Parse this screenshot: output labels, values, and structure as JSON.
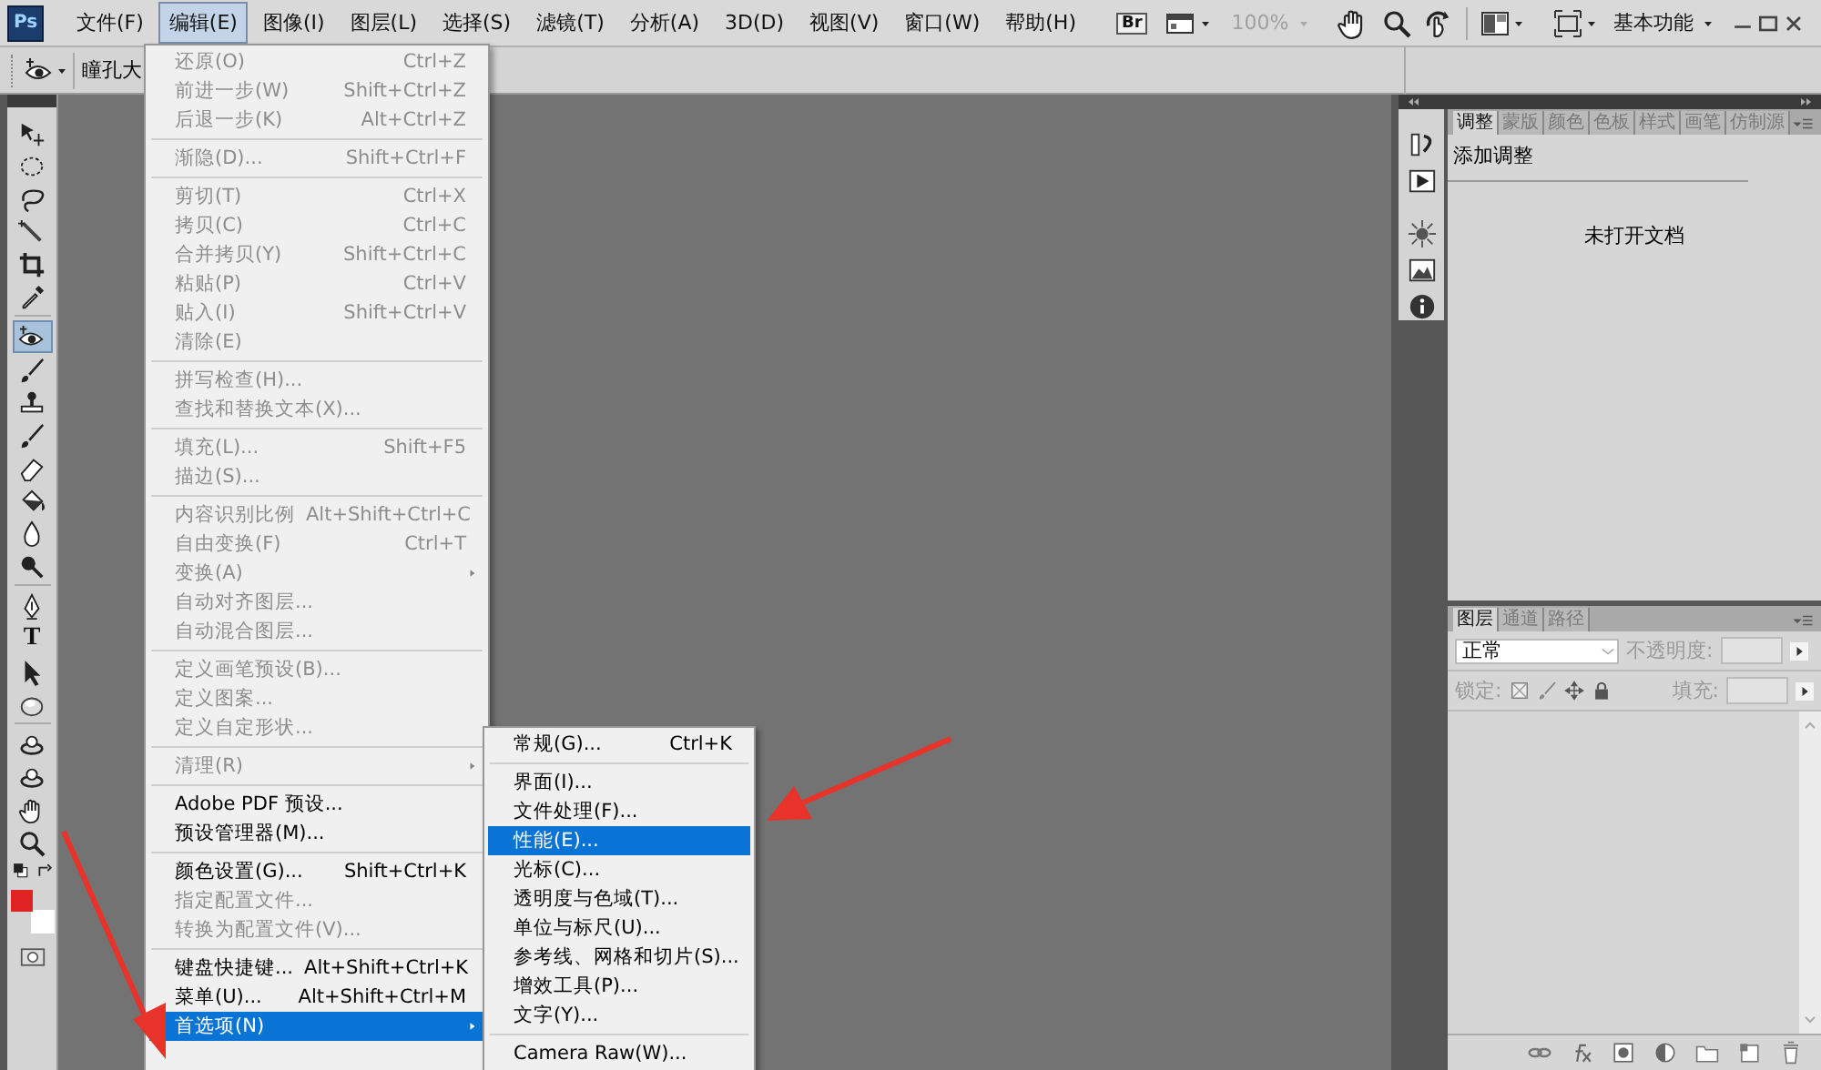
{
  "menubar": {
    "logo": "Ps",
    "items": [
      {
        "label": "文件(F)",
        "selected": false
      },
      {
        "label": "编辑(E)",
        "selected": true
      },
      {
        "label": "图像(I)",
        "selected": false
      },
      {
        "label": "图层(L)",
        "selected": false
      },
      {
        "label": "选择(S)",
        "selected": false
      },
      {
        "label": "滤镜(T)",
        "selected": false
      },
      {
        "label": "分析(A)",
        "selected": false
      },
      {
        "label": "3D(D)",
        "selected": false
      },
      {
        "label": "视图(V)",
        "selected": false
      },
      {
        "label": "窗口(W)",
        "selected": false
      },
      {
        "label": "帮助(H)",
        "selected": false
      }
    ],
    "bridge": "Br",
    "zoom": "100%",
    "workspace": "基本功能"
  },
  "options_bar": {
    "field_label": "瞳孔大"
  },
  "tools": [
    {
      "kind": "move",
      "selected": false
    },
    {
      "kind": "ellipse",
      "selected": false
    },
    {
      "kind": "lasso",
      "selected": false
    },
    {
      "kind": "wand",
      "selected": false
    },
    {
      "kind": "crop",
      "selected": false
    },
    {
      "kind": "eyedropper",
      "selected": false
    },
    {
      "kind": "eye",
      "selected": true
    },
    {
      "kind": "brush",
      "selected": false
    },
    {
      "kind": "stamp",
      "selected": false
    },
    {
      "kind": "brush",
      "selected": false
    },
    {
      "kind": "eraser",
      "selected": false
    },
    {
      "kind": "bucket",
      "selected": false
    },
    {
      "kind": "drop",
      "selected": false
    },
    {
      "kind": "dodge",
      "selected": false
    },
    {
      "kind": "pen",
      "selected": false
    },
    {
      "kind": "type",
      "glyph": "T",
      "selected": false
    },
    {
      "kind": "pointer",
      "selected": false
    },
    {
      "kind": "shape",
      "selected": false
    },
    {
      "kind": "orbit",
      "selected": false
    },
    {
      "kind": "orbit",
      "selected": false
    },
    {
      "kind": "hand",
      "selected": false
    },
    {
      "kind": "zoom",
      "selected": false
    }
  ],
  "swatches": [
    {
      "color": "#e02424"
    },
    {
      "color": "#ffffff"
    }
  ],
  "edit_menu": {
    "groups": [
      [
        {
          "label": "还原(O)",
          "shortcut": "Ctrl+Z",
          "disabled": true,
          "has_submenu": false,
          "selected": false
        },
        {
          "label": "前进一步(W)",
          "shortcut": "Shift+Ctrl+Z",
          "disabled": true,
          "has_submenu": false,
          "selected": false
        },
        {
          "label": "后退一步(K)",
          "shortcut": "Alt+Ctrl+Z",
          "disabled": true,
          "has_submenu": false,
          "selected": false
        }
      ],
      [
        {
          "label": "渐隐(D)...",
          "shortcut": "Shift+Ctrl+F",
          "disabled": true,
          "has_submenu": false,
          "selected": false
        }
      ],
      [
        {
          "label": "剪切(T)",
          "shortcut": "Ctrl+X",
          "disabled": true,
          "has_submenu": false,
          "selected": false
        },
        {
          "label": "拷贝(C)",
          "shortcut": "Ctrl+C",
          "disabled": true,
          "has_submenu": false,
          "selected": false
        },
        {
          "label": "合并拷贝(Y)",
          "shortcut": "Shift+Ctrl+C",
          "disabled": true,
          "has_submenu": false,
          "selected": false
        },
        {
          "label": "粘贴(P)",
          "shortcut": "Ctrl+V",
          "disabled": true,
          "has_submenu": false,
          "selected": false
        },
        {
          "label": "贴入(I)",
          "shortcut": "Shift+Ctrl+V",
          "disabled": true,
          "has_submenu": false,
          "selected": false
        },
        {
          "label": "清除(E)",
          "disabled": true,
          "has_submenu": false,
          "selected": false
        }
      ],
      [
        {
          "label": "拼写检查(H)...",
          "disabled": true,
          "has_submenu": false,
          "selected": false
        },
        {
          "label": "查找和替换文本(X)...",
          "disabled": true,
          "has_submenu": false,
          "selected": false
        }
      ],
      [
        {
          "label": "填充(L)...",
          "shortcut": "Shift+F5",
          "disabled": true,
          "has_submenu": false,
          "selected": false
        },
        {
          "label": "描边(S)...",
          "disabled": true,
          "has_submenu": false,
          "selected": false
        }
      ],
      [
        {
          "label": "内容识别比例",
          "shortcut": "Alt+Shift+Ctrl+C",
          "disabled": true,
          "has_submenu": false,
          "selected": false
        },
        {
          "label": "自由变换(F)",
          "shortcut": "Ctrl+T",
          "disabled": true,
          "has_submenu": false,
          "selected": false
        },
        {
          "label": "变换(A)",
          "disabled": true,
          "has_submenu": true,
          "selected": false
        },
        {
          "label": "自动对齐图层...",
          "disabled": true,
          "has_submenu": false,
          "selected": false
        },
        {
          "label": "自动混合图层...",
          "disabled": true,
          "has_submenu": false,
          "selected": false
        }
      ],
      [
        {
          "label": "定义画笔预设(B)...",
          "disabled": true,
          "has_submenu": false,
          "selected": false
        },
        {
          "label": "定义图案...",
          "disabled": true,
          "has_submenu": false,
          "selected": false
        },
        {
          "label": "定义自定形状...",
          "disabled": true,
          "has_submenu": false,
          "selected": false
        }
      ],
      [
        {
          "label": "清理(R)",
          "disabled": true,
          "has_submenu": true,
          "selected": false
        }
      ],
      [
        {
          "label": "Adobe PDF 预设...",
          "disabled": false,
          "has_submenu": false,
          "selected": false
        },
        {
          "label": "预设管理器(M)...",
          "disabled": false,
          "has_submenu": false,
          "selected": false
        }
      ],
      [
        {
          "label": "颜色设置(G)...",
          "shortcut": "Shift+Ctrl+K",
          "disabled": false,
          "has_submenu": false,
          "selected": false
        },
        {
          "label": "指定配置文件...",
          "disabled": true,
          "has_submenu": false,
          "selected": false
        },
        {
          "label": "转换为配置文件(V)...",
          "disabled": true,
          "has_submenu": false,
          "selected": false
        }
      ],
      [
        {
          "label": "键盘快捷键...",
          "shortcut": "Alt+Shift+Ctrl+K",
          "disabled": false,
          "has_submenu": false,
          "selected": false
        },
        {
          "label": "菜单(U)...",
          "shortcut": "Alt+Shift+Ctrl+M",
          "disabled": false,
          "has_submenu": false,
          "selected": false
        },
        {
          "label": "首选项(N)",
          "disabled": false,
          "has_submenu": true,
          "selected": true
        }
      ]
    ]
  },
  "submenu": {
    "groups": [
      [
        {
          "label": "常规(G)...",
          "shortcut": "Ctrl+K",
          "disabled": false,
          "has_submenu": false,
          "selected": false
        }
      ],
      [
        {
          "label": "界面(I)...",
          "disabled": false,
          "has_submenu": false,
          "selected": false
        },
        {
          "label": "文件处理(F)...",
          "disabled": false,
          "has_submenu": false,
          "selected": false
        },
        {
          "label": "性能(E)...",
          "disabled": false,
          "has_submenu": false,
          "selected": true
        },
        {
          "label": "光标(C)...",
          "disabled": false,
          "has_submenu": false,
          "selected": false
        },
        {
          "label": "透明度与色域(T)...",
          "disabled": false,
          "has_submenu": false,
          "selected": false
        },
        {
          "label": "单位与标尺(U)...",
          "disabled": false,
          "has_submenu": false,
          "selected": false
        },
        {
          "label": "参考线、网格和切片(S)...",
          "disabled": false,
          "has_submenu": false,
          "selected": false
        },
        {
          "label": "增效工具(P)...",
          "disabled": false,
          "has_submenu": false,
          "selected": false
        },
        {
          "label": "文字(Y)...",
          "disabled": false,
          "has_submenu": false,
          "selected": false
        }
      ],
      [
        {
          "label": "Camera Raw(W)...",
          "disabled": false,
          "has_submenu": false,
          "selected": false
        }
      ]
    ]
  },
  "adjustments_panel": {
    "tabs": [
      {
        "label": "调整",
        "selected": true
      },
      {
        "label": "蒙版",
        "selected": false
      },
      {
        "label": "颜色",
        "selected": false
      },
      {
        "label": "色板",
        "selected": false
      },
      {
        "label": "样式",
        "selected": false
      },
      {
        "label": "画笔",
        "selected": false
      },
      {
        "label": "仿制源",
        "selected": false
      }
    ],
    "heading": "添加调整",
    "message": "未打开文档"
  },
  "layers_panel": {
    "tabs": [
      {
        "label": "图层",
        "selected": true
      },
      {
        "label": "通道",
        "selected": false
      },
      {
        "label": "路径",
        "selected": false
      }
    ],
    "blend_mode": "正常",
    "opacity_label": "不透明度:",
    "lock_label": "锁定:",
    "fill_label": "填充:"
  }
}
